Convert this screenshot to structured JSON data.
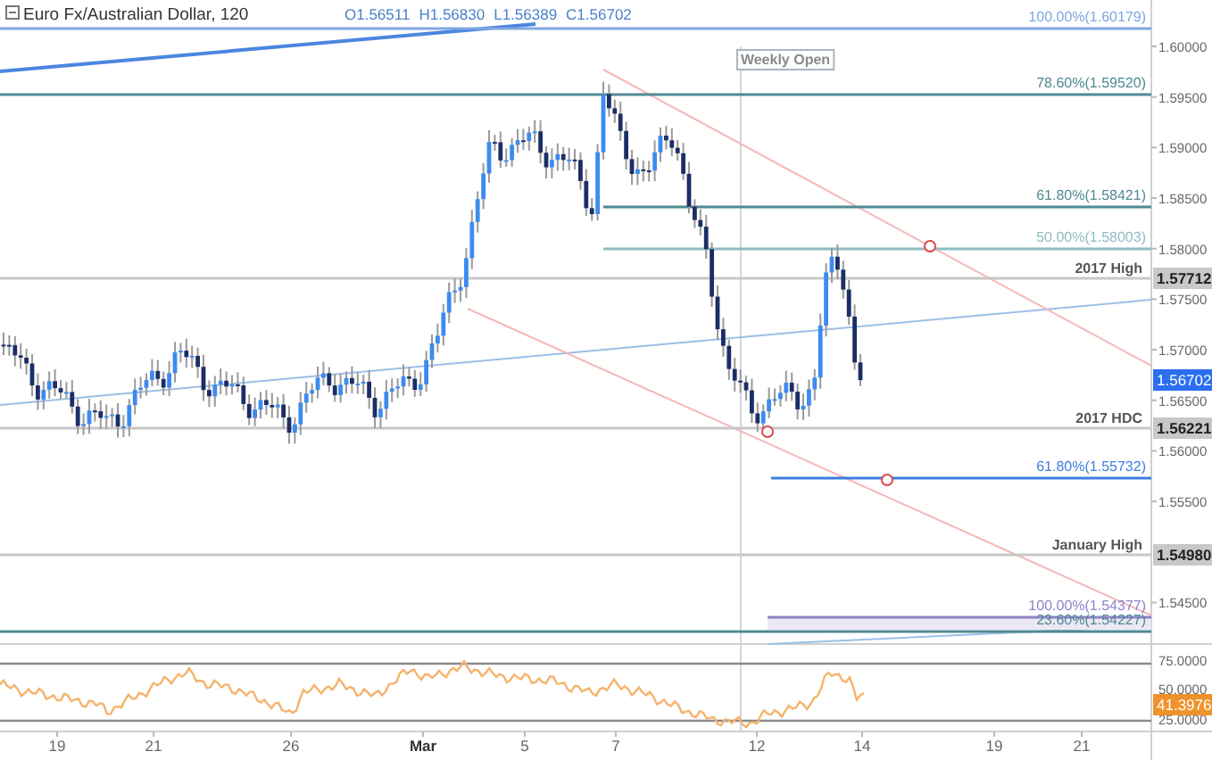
{
  "header": {
    "title": "Euro Fx/Australian Dollar, 120",
    "ohlc": [
      "O1.56511",
      "H1.56830",
      "L1.56389",
      "C1.56702"
    ]
  },
  "levels": [
    {
      "kind": "fib",
      "label": "100.00%(1.60179)",
      "color": "#7fa7e0"
    },
    {
      "kind": "fib",
      "label": "78.60%(1.59520)",
      "color": "#4f8a92"
    },
    {
      "kind": "fib",
      "label": "61.80%(1.58421)",
      "color": "#4f8a92"
    },
    {
      "kind": "fib",
      "label": "50.00%(1.58003)",
      "color": "#8fbcc2"
    },
    {
      "kind": "level",
      "label": "2017 High",
      "price": "1.57712"
    },
    {
      "kind": "level",
      "label": "2017 HDC",
      "price": "1.56221"
    },
    {
      "kind": "fib",
      "label": "61.80%(1.55732)",
      "color": "#3d7de0"
    },
    {
      "kind": "level",
      "label": "January High",
      "price": "1.54980"
    },
    {
      "kind": "fib",
      "label": "100.00%(1.54377)",
      "color": "#8f83c9"
    },
    {
      "kind": "fib",
      "label": "23.60%(1.54227)",
      "color": "#4f8a92"
    }
  ],
  "weekly_open": "Weekly Open",
  "price_axis": {
    "ticks": [
      "1.60000",
      "1.59500",
      "1.59000",
      "1.58500",
      "1.58000",
      "1.57500",
      "1.57000",
      "1.56500",
      "1.56000",
      "1.55500",
      "1.54500"
    ],
    "current": "1.56702"
  },
  "rsi": {
    "ticks": [
      "75.0000",
      "50.0000",
      "25.0000"
    ],
    "value": "41.3976"
  },
  "time_axis": [
    {
      "text": "19",
      "bold": false
    },
    {
      "text": "21",
      "bold": false
    },
    {
      "text": "26",
      "bold": false
    },
    {
      "text": "Mar",
      "bold": true
    },
    {
      "text": "5",
      "bold": false
    },
    {
      "text": "7",
      "bold": false
    },
    {
      "text": "12",
      "bold": false
    },
    {
      "text": "14",
      "bold": false
    },
    {
      "text": "19",
      "bold": false
    },
    {
      "text": "21",
      "bold": false
    }
  ]
}
